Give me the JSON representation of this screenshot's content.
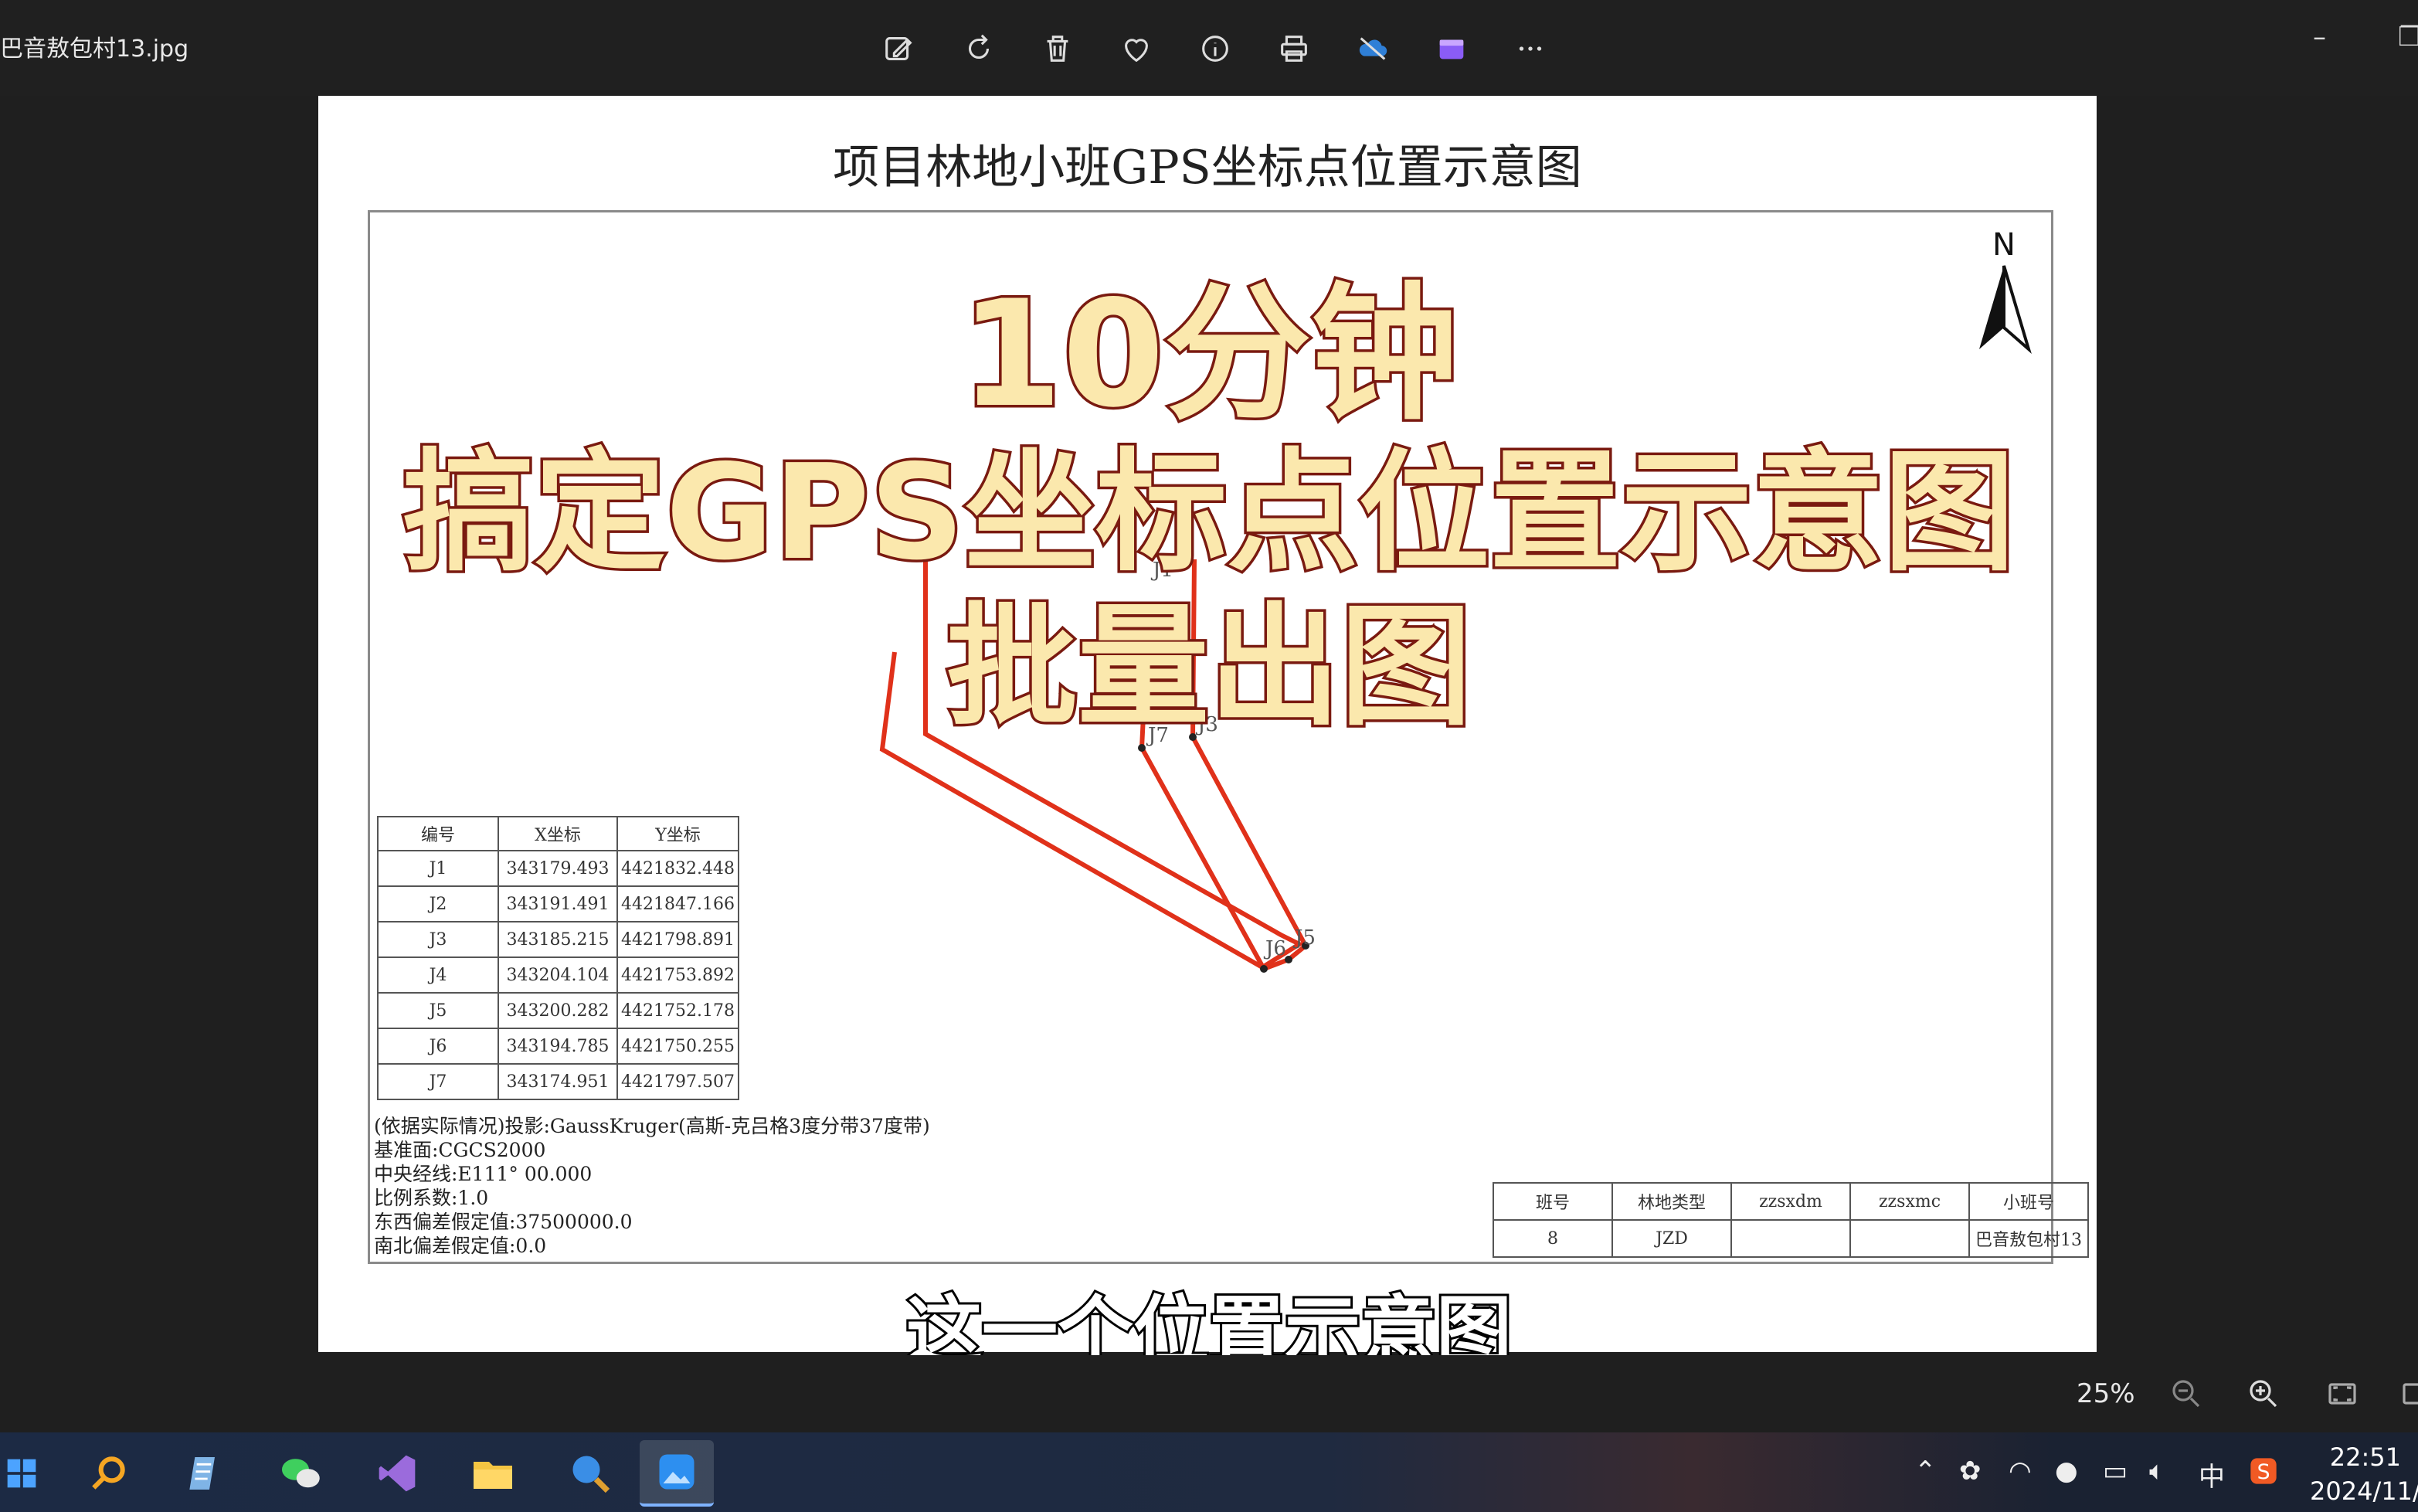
{
  "window": {
    "file_title": "巴音敖包村13.jpg",
    "toolbar_icons": [
      "edit-image-icon",
      "rotate-icon",
      "delete-icon",
      "favorite-icon",
      "info-icon",
      "print-icon",
      "onedrive-icon",
      "clipchamp-icon",
      "more-icon"
    ],
    "minimize": "–",
    "restore": "❐"
  },
  "document": {
    "title": "项目林地小班GPS坐标点位置示意图",
    "north_label": "N",
    "table": {
      "headers": [
        "编号",
        "X坐标",
        "Y坐标"
      ],
      "rows": [
        [
          "J1",
          "343179.493",
          "4421832.448"
        ],
        [
          "J2",
          "343191.491",
          "4421847.166"
        ],
        [
          "J3",
          "343185.215",
          "4421798.891"
        ],
        [
          "J4",
          "343204.104",
          "4421753.892"
        ],
        [
          "J5",
          "343200.282",
          "4421752.178"
        ],
        [
          "J6",
          "343194.785",
          "4421750.255"
        ],
        [
          "J7",
          "343174.951",
          "4421797.507"
        ]
      ]
    },
    "notes": [
      "(依据实际情况)投影:GaussKruger(高斯-克吕格3度分带37度带)",
      "基准面:CGCS2000",
      "中央经线:E111° 00.000",
      "比例系数:1.0",
      "东西偏差假定值:37500000.0",
      "南北偏差假定值:0.0"
    ],
    "info_table": {
      "headers": [
        "班号",
        "林地类型",
        "zzsxdm",
        "zzsxmc",
        "小班号"
      ],
      "values": [
        "8",
        "JZD",
        "",
        "",
        "巴音敖包村13"
      ]
    },
    "point_labels": {
      "j1": "J1",
      "j3": "J3",
      "j5": "J5",
      "j6": "J6",
      "j7": "J7"
    }
  },
  "overlay": {
    "line1": "10分钟",
    "line2": "搞定GPS坐标点位置示意图",
    "line3": "批量出图",
    "subtitle": "这一个位置示意图"
  },
  "zoom": {
    "value": "25%"
  },
  "taskbar": {
    "tray_lang": "中",
    "time": "22:51",
    "date": "2024/11/"
  },
  "colors": {
    "parcel_line": "#e0311a",
    "overlay_fill": "#fbe8ad",
    "overlay_stroke": "#7a1a10"
  }
}
